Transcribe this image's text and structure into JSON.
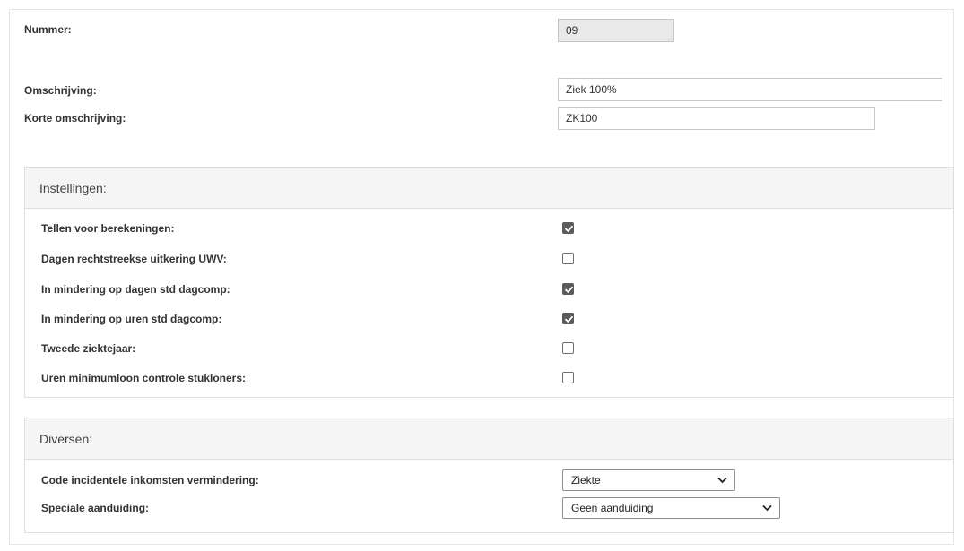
{
  "general": {
    "nummer_label": "Nummer:",
    "nummer_value": "09",
    "omschrijving_label": "Omschrijving:",
    "omschrijving_value": "Ziek 100%",
    "korte_label": "Korte omschrijving:",
    "korte_value": "ZK100"
  },
  "instellingen": {
    "title": "Instellingen:",
    "rows": [
      {
        "label": "Tellen voor berekeningen:",
        "checked": true
      },
      {
        "label": "Dagen rechtstreekse uitkering UWV:",
        "checked": false
      },
      {
        "label": "In mindering op dagen std dagcomp:",
        "checked": true
      },
      {
        "label": "In mindering op uren std dagcomp:",
        "checked": true
      },
      {
        "label": "Tweede ziektejaar:",
        "checked": false
      },
      {
        "label": "Uren minimumloon controle stukloners:",
        "checked": false
      }
    ]
  },
  "diversen": {
    "title": "Diversen:",
    "code_label": "Code incidentele inkomsten vermindering:",
    "code_value": "Ziekte",
    "speciale_label": "Speciale aanduiding:",
    "speciale_value": "Geen aanduiding"
  },
  "icons": {
    "checkbox_checked": "checkmark-icon",
    "select_arrow": "chevron-down-icon"
  }
}
